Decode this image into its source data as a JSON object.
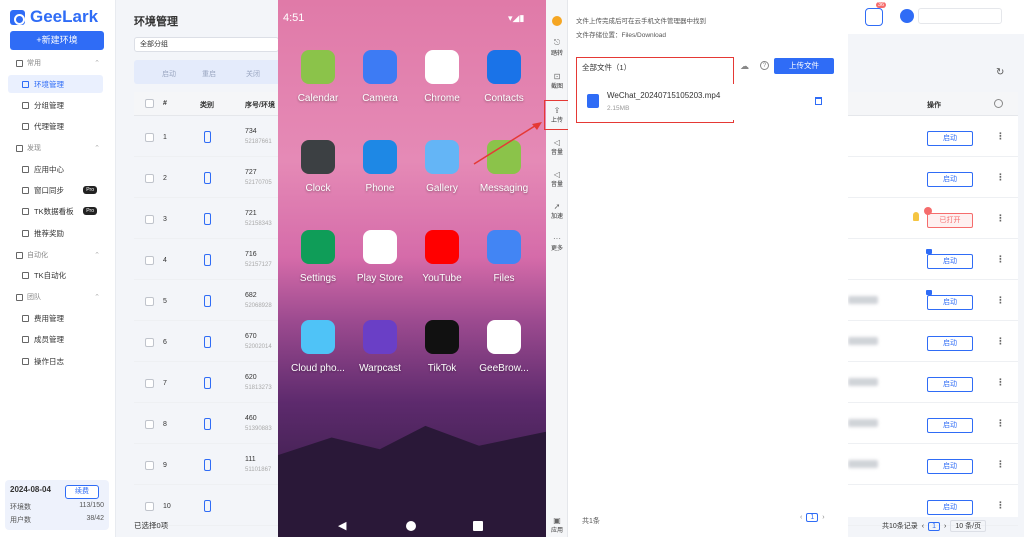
{
  "sidebar": {
    "logo_text": "GeeLark",
    "new_env_label": "+新建环境",
    "sections": [
      {
        "label": "常用",
        "items": [
          {
            "label": "环境管理",
            "active": true
          },
          {
            "label": "分组管理"
          },
          {
            "label": "代理管理"
          }
        ]
      },
      {
        "label": "发现",
        "items": [
          {
            "label": "应用中心"
          },
          {
            "label": "窗口同步",
            "badge": "Pro"
          },
          {
            "label": "TK数据看板",
            "badge": "Pro"
          },
          {
            "label": "推荐奖励"
          }
        ]
      },
      {
        "label": "自动化",
        "items": [
          {
            "label": "TK自动化"
          }
        ]
      },
      {
        "label": "团队",
        "items": [
          {
            "label": "费用管理"
          },
          {
            "label": "成员管理"
          },
          {
            "label": "操作日志"
          }
        ]
      }
    ],
    "quota": {
      "date": "2024-08-04",
      "renew_label": "续费",
      "env_count_label": "环境数",
      "env_count_value": "113/150",
      "user_count_label": "用户数",
      "user_count_value": "38/42"
    }
  },
  "main": {
    "title": "环境管理",
    "group_select": "全部分组",
    "actions": [
      "启动",
      "重启",
      "关闭"
    ],
    "columns": [
      "#",
      "类别",
      "序号/环境"
    ],
    "operation_column": "操作",
    "rows": [
      {
        "num": "1",
        "serial": "734",
        "sub": "52187661"
      },
      {
        "num": "2",
        "serial": "727",
        "sub": "52170705"
      },
      {
        "num": "3",
        "serial": "721",
        "sub": "52158343"
      },
      {
        "num": "4",
        "serial": "716",
        "sub": "52157127"
      },
      {
        "num": "5",
        "serial": "682",
        "sub": "52068928"
      },
      {
        "num": "6",
        "serial": "670",
        "sub": "52002014"
      },
      {
        "num": "7",
        "serial": "620",
        "sub": "51813273"
      },
      {
        "num": "8",
        "serial": "460",
        "sub": "51390883"
      },
      {
        "num": "9",
        "serial": "111",
        "sub": "51101867"
      },
      {
        "num": "10",
        "serial": "",
        "sub": ""
      }
    ],
    "row_buttons": [
      "启动",
      "启动",
      "已打开",
      "启动",
      "启动",
      "启动",
      "启动",
      "启动",
      "启动",
      "启动"
    ],
    "selected_text": "已选择0项",
    "pagination": {
      "total": "共10条记录",
      "page": "1",
      "per_page": "10 条/页"
    }
  },
  "header": {
    "notif_count": "36"
  },
  "phone": {
    "time": "4:51",
    "apps": [
      {
        "label": "Calendar",
        "color": "#8bc34a"
      },
      {
        "label": "Camera",
        "color": "#3d7bf4"
      },
      {
        "label": "Chrome",
        "color": "#ffffff"
      },
      {
        "label": "Contacts",
        "color": "#1a73e8"
      },
      {
        "label": "Clock",
        "color": "#3c4043"
      },
      {
        "label": "Phone",
        "color": "#1e88e5"
      },
      {
        "label": "Gallery",
        "color": "#64b5f6"
      },
      {
        "label": "Messaging",
        "color": "#8bc34a"
      },
      {
        "label": "Settings",
        "color": "#0f9d58"
      },
      {
        "label": "Play Store",
        "color": "#ffffff"
      },
      {
        "label": "YouTube",
        "color": "#ff0000"
      },
      {
        "label": "Files",
        "color": "#4285f4"
      },
      {
        "label": "Cloud pho...",
        "color": "#4fc3f7"
      },
      {
        "label": "Warpcast",
        "color": "#6a3fc6"
      },
      {
        "label": "TikTok",
        "color": "#111111"
      },
      {
        "label": "GeeBrow...",
        "color": "#ffffff"
      }
    ]
  },
  "phone_tools": [
    "踏转",
    "截图",
    "上传",
    "音量",
    "音量",
    "加速",
    "更多",
    "应用"
  ],
  "upload_panel": {
    "tip1": "文件上传完成后可在云手机文件管理器中找到",
    "tip2": "文件存储位置：Files/Download",
    "all_files": "全部文件（1）",
    "upload_btn": "上传文件",
    "file_name": "WeChat_20240715105203.mp4",
    "file_size": "2.15MB",
    "total": "共1条",
    "page": "1"
  }
}
